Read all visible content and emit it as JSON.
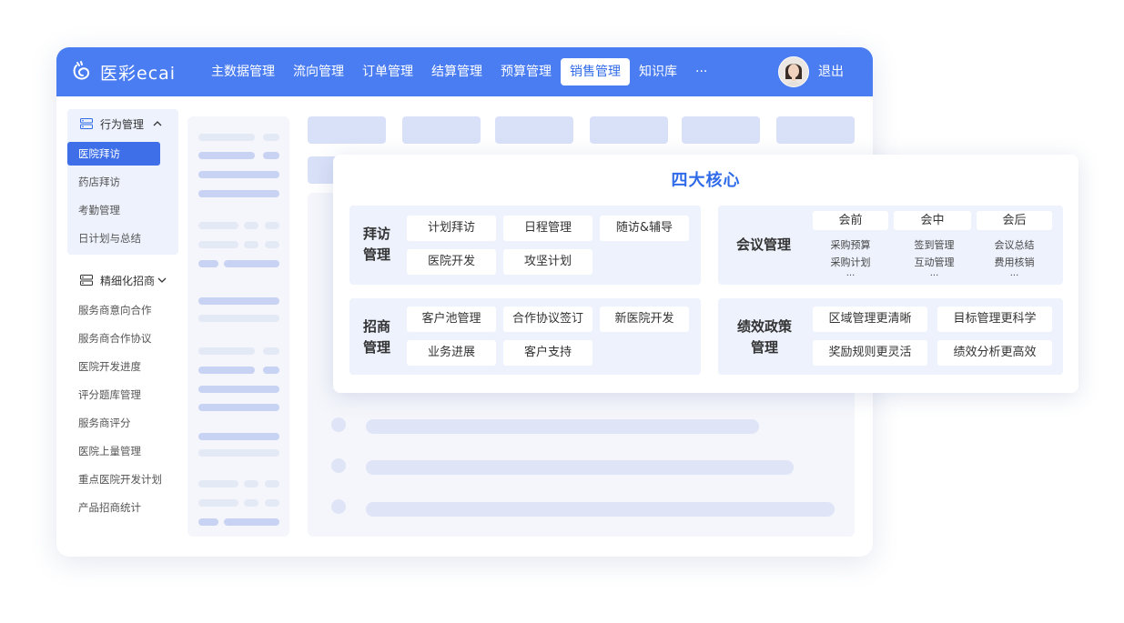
{
  "app": {
    "logo_text": "医彩ecai",
    "nav": [
      "主数据管理",
      "流向管理",
      "订单管理",
      "结算管理",
      "预算管理",
      "销售管理",
      "知识库",
      "···"
    ],
    "active_nav": "销售管理",
    "logout": "退出"
  },
  "sidebar": {
    "group1": {
      "label": "行为管理",
      "items": [
        "医院拜访",
        "药店拜访",
        "考勤管理",
        "日计划与总结"
      ],
      "active": "医院拜访"
    },
    "group2": {
      "label": "精细化招商",
      "items": [
        "服务商意向合作",
        "服务商合作协议",
        "医院开发进度",
        "评分题库管理",
        "服务商评分",
        "医院上量管理",
        "重点医院开发计划",
        "产品招商统计"
      ]
    }
  },
  "card": {
    "title": "四大核心",
    "visit": {
      "label_line1": "拜访",
      "label_line2": "管理",
      "chips": [
        "计划拜访",
        "日程管理",
        "随访&辅导",
        "医院开发",
        "攻坚计划"
      ]
    },
    "meeting": {
      "label": "会议管理",
      "phases": [
        "会前",
        "会中",
        "会后"
      ],
      "before": [
        "采购预算",
        "采购计划",
        "···"
      ],
      "during": [
        "签到管理",
        "互动管理",
        "···"
      ],
      "after": [
        "会议总结",
        "费用核销",
        "···"
      ]
    },
    "investment": {
      "label_line1": "招商",
      "label_line2": "管理",
      "chips": [
        "客户池管理",
        "合作协议签订",
        "新医院开发",
        "业务进展",
        "客户支持"
      ]
    },
    "performance": {
      "label_line1": "绩效政策",
      "label_line2": "管理",
      "chips": [
        "区域管理更清晰",
        "目标管理更科学",
        "奖励规则更灵活",
        "绩效分析更高效"
      ]
    }
  },
  "colors": {
    "primary": "#4a7cf2",
    "accent": "#2f6be8",
    "panel": "#eef2fd",
    "skeleton": "#d9e1f8"
  }
}
